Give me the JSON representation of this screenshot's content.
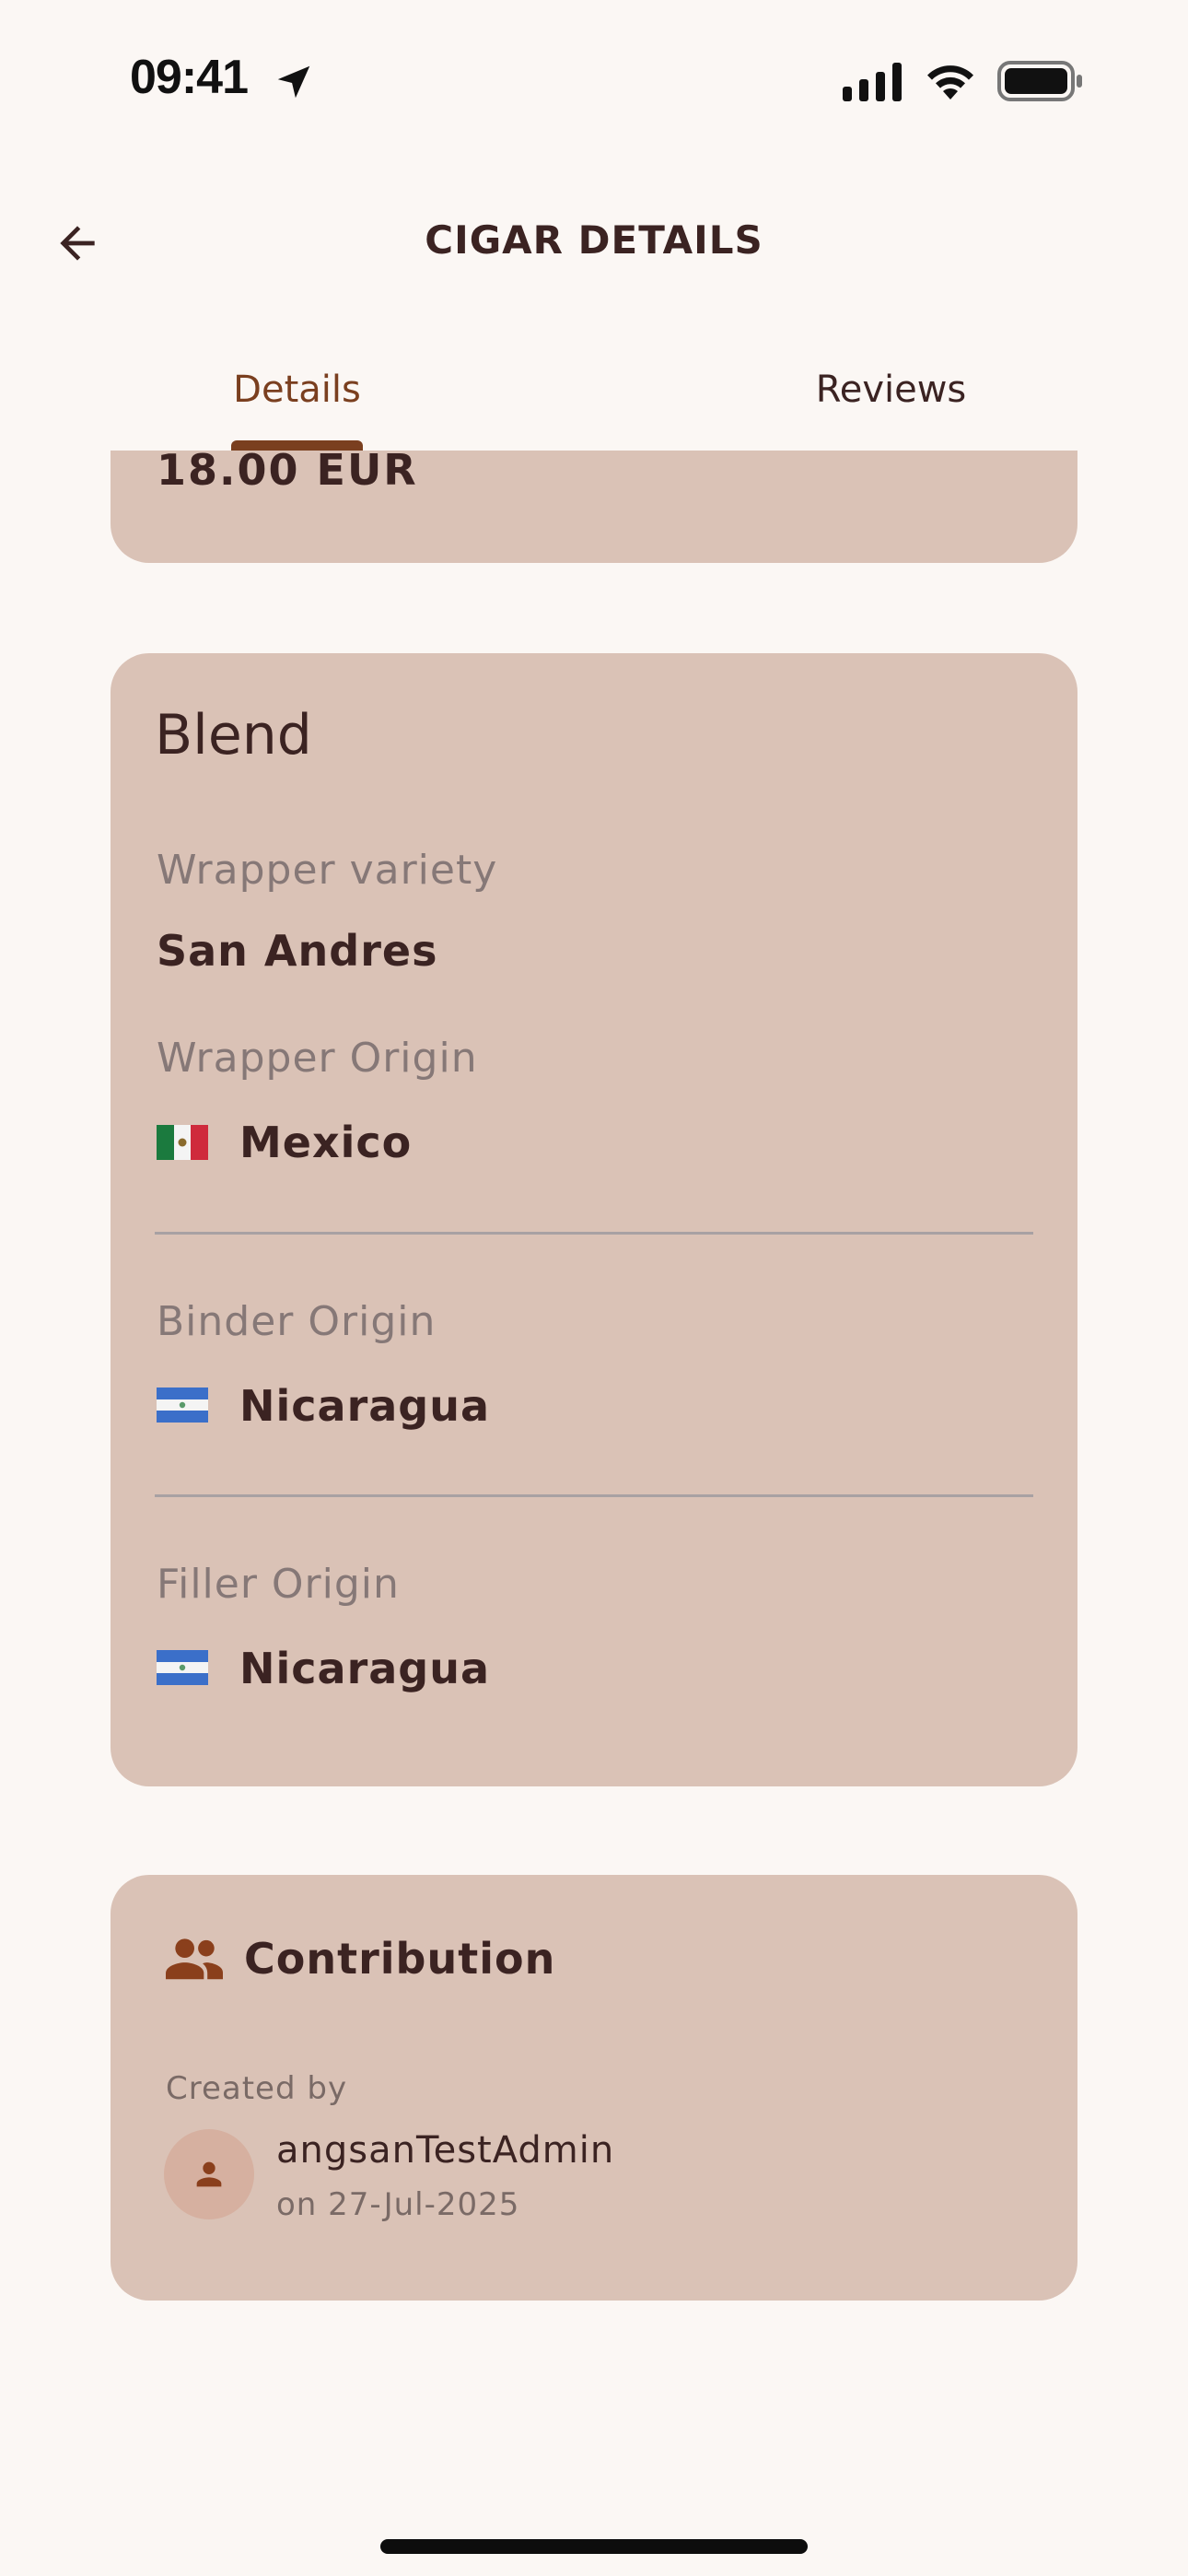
{
  "status_bar": {
    "time": "09:41",
    "icons": [
      "location-arrow-icon",
      "cellular-signal-icon",
      "wifi-icon",
      "battery-icon"
    ]
  },
  "app_bar": {
    "back_icon": "arrow-back-icon",
    "title": "CIGAR DETAILS"
  },
  "tabs": {
    "items": [
      {
        "label": "Details",
        "selected": true
      },
      {
        "label": "Reviews",
        "selected": false
      }
    ]
  },
  "price": {
    "value": "18.00 EUR"
  },
  "blend": {
    "title": "Blend",
    "wrapper_variety": {
      "label": "Wrapper variety",
      "value": "San Andres"
    },
    "wrapper_origin": {
      "label": "Wrapper Origin",
      "value": "Mexico",
      "flag": "mexico-flag-icon"
    },
    "binder_origin": {
      "label": "Binder Origin",
      "value": "Nicaragua",
      "flag": "nicaragua-flag-icon"
    },
    "filler_origin": {
      "label": "Filler Origin",
      "value": "Nicaragua",
      "flag": "nicaragua-flag-icon"
    }
  },
  "contribution": {
    "icon": "people-icon",
    "title": "Contribution",
    "created_by_label": "Created by",
    "username": "angsanTestAdmin",
    "date": "on 27-Jul-2025",
    "avatar_icon": "person-icon"
  },
  "colors": {
    "background": "#fbf7f4",
    "card": "#dac2b6",
    "accent": "#7a3f1f",
    "text_primary": "#3b2322",
    "text_secondary": "#867877"
  }
}
